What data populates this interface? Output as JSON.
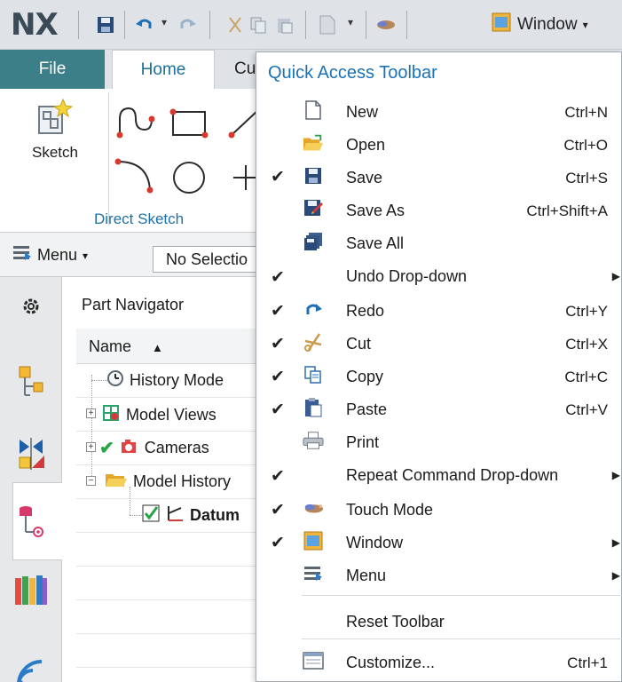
{
  "app": {
    "logo": "NX"
  },
  "qat": {
    "window_label": "Window"
  },
  "ribbon": {
    "tabs": [
      "File",
      "Home",
      "Cu"
    ],
    "sketch_label": "Sketch",
    "group_label": "Direct Sketch",
    "menu_label": "Menu",
    "selection_filter": "No Selectio"
  },
  "navigator": {
    "title": "Part Navigator",
    "column_name": "Name",
    "items": [
      {
        "label": "History Mode"
      },
      {
        "label": "Model Views"
      },
      {
        "label": "Cameras"
      },
      {
        "label": "Model History"
      },
      {
        "label": "Datum"
      }
    ]
  },
  "dropdown": {
    "title": "Quick Access Toolbar",
    "items": [
      {
        "label": "New",
        "shortcut": "Ctrl+N",
        "checked": false,
        "icon": "new-file-icon"
      },
      {
        "label": "Open",
        "shortcut": "Ctrl+O",
        "checked": false,
        "icon": "open-folder-icon"
      },
      {
        "label": "Save",
        "shortcut": "Ctrl+S",
        "checked": true,
        "icon": "save-icon"
      },
      {
        "label": "Save As",
        "shortcut": "Ctrl+Shift+A",
        "checked": false,
        "icon": "save-as-icon"
      },
      {
        "label": "Save All",
        "shortcut": "",
        "checked": false,
        "icon": "save-all-icon"
      },
      {
        "label": "Undo Drop-down",
        "shortcut": "",
        "checked": true,
        "icon": "",
        "submenu": true
      },
      {
        "label": "Redo",
        "shortcut": "Ctrl+Y",
        "checked": true,
        "icon": "redo-icon"
      },
      {
        "label": "Cut",
        "shortcut": "Ctrl+X",
        "checked": true,
        "icon": "cut-icon"
      },
      {
        "label": "Copy",
        "shortcut": "Ctrl+C",
        "checked": true,
        "icon": "copy-icon"
      },
      {
        "label": "Paste",
        "shortcut": "Ctrl+V",
        "checked": true,
        "icon": "paste-icon"
      },
      {
        "label": "Print",
        "shortcut": "",
        "checked": false,
        "icon": "print-icon"
      },
      {
        "label": "Repeat Command Drop-down",
        "shortcut": "",
        "checked": true,
        "icon": "",
        "submenu": true
      },
      {
        "label": "Touch Mode",
        "shortcut": "",
        "checked": true,
        "icon": "touch-mode-icon"
      },
      {
        "label": "Window",
        "shortcut": "",
        "checked": true,
        "icon": "window-icon",
        "submenu": true
      },
      {
        "label": "Menu",
        "shortcut": "",
        "checked": false,
        "icon": "menu-icon",
        "submenu": true
      }
    ],
    "reset_label": "Reset Toolbar",
    "customize_label": "Customize...",
    "customize_shortcut": "Ctrl+1"
  },
  "colors": {
    "file_tab": "#3d7f88",
    "home_tab_text": "#1b6f9a",
    "dropdown_title": "#1b72b8",
    "ribbon_bg": "#dfe3e7"
  }
}
